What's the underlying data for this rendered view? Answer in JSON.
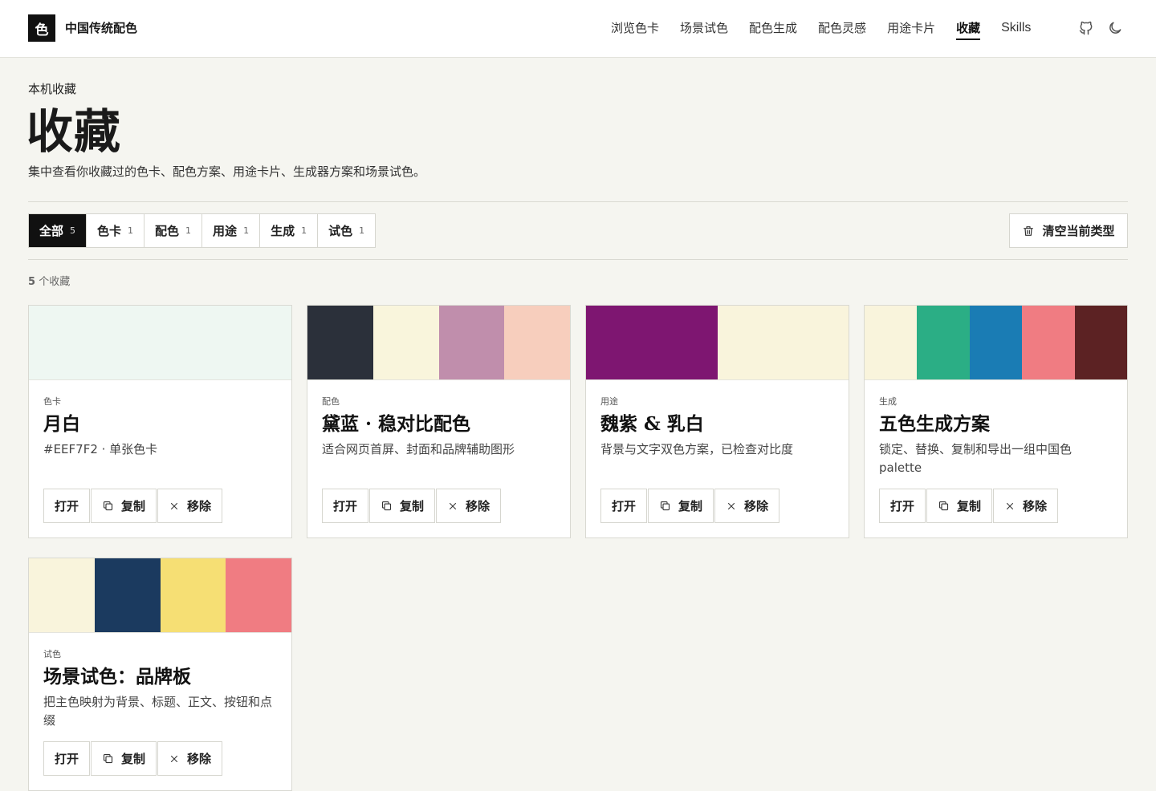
{
  "header": {
    "logo_char": "色",
    "brand": "中国传统配色",
    "nav": [
      {
        "label": "浏览色卡",
        "active": false
      },
      {
        "label": "场景试色",
        "active": false
      },
      {
        "label": "配色生成",
        "active": false
      },
      {
        "label": "配色灵感",
        "active": false
      },
      {
        "label": "用途卡片",
        "active": false
      },
      {
        "label": "收藏",
        "active": true
      },
      {
        "label": "Skills",
        "active": false
      }
    ]
  },
  "page": {
    "eyebrow": "本机收藏",
    "title": "收藏",
    "description": "集中查看你收藏过的色卡、配色方案、用途卡片、生成器方案和场景试色。"
  },
  "filters": [
    {
      "label": "全部",
      "count": "5",
      "active": true
    },
    {
      "label": "色卡",
      "count": "1",
      "active": false
    },
    {
      "label": "配色",
      "count": "1",
      "active": false
    },
    {
      "label": "用途",
      "count": "1",
      "active": false
    },
    {
      "label": "生成",
      "count": "1",
      "active": false
    },
    {
      "label": "试色",
      "count": "1",
      "active": false
    }
  ],
  "clear_label": "清空当前类型",
  "result_count": {
    "number": "5",
    "suffix": "个收藏"
  },
  "actions": {
    "open": "打开",
    "copy": "复制",
    "remove": "移除"
  },
  "cards": [
    {
      "kind": "色卡",
      "title": "月白",
      "desc": "#EEF7F2 · 单张色卡",
      "colors": [
        "#EEF7F2"
      ]
    },
    {
      "kind": "配色",
      "title": "黛蓝 · 稳对比配色",
      "desc": "适合网页首屏、封面和品牌辅助图形",
      "colors": [
        "#2B303A",
        "#F9F5DC",
        "#C08EAC",
        "#F7CEBD"
      ]
    },
    {
      "kind": "用途",
      "title": "魏紫 & 乳白",
      "desc": "背景与文字双色方案，已检查对比度",
      "colors": [
        "#7E1671",
        "#F9F4DC"
      ]
    },
    {
      "kind": "生成",
      "title": "五色生成方案",
      "desc": "锁定、替换、复制和导出一组中国色 palette",
      "colors": [
        "#F9F4DC",
        "#2BAE85",
        "#1A7CB4",
        "#F07C82",
        "#5C2223"
      ]
    },
    {
      "kind": "试色",
      "title": "场景试色：品牌板",
      "desc": "把主色映射为背景、标题、正文、按钮和点缀",
      "colors": [
        "#F9F4DC",
        "#1B3A5F",
        "#F6DF74",
        "#F07C82"
      ]
    }
  ]
}
